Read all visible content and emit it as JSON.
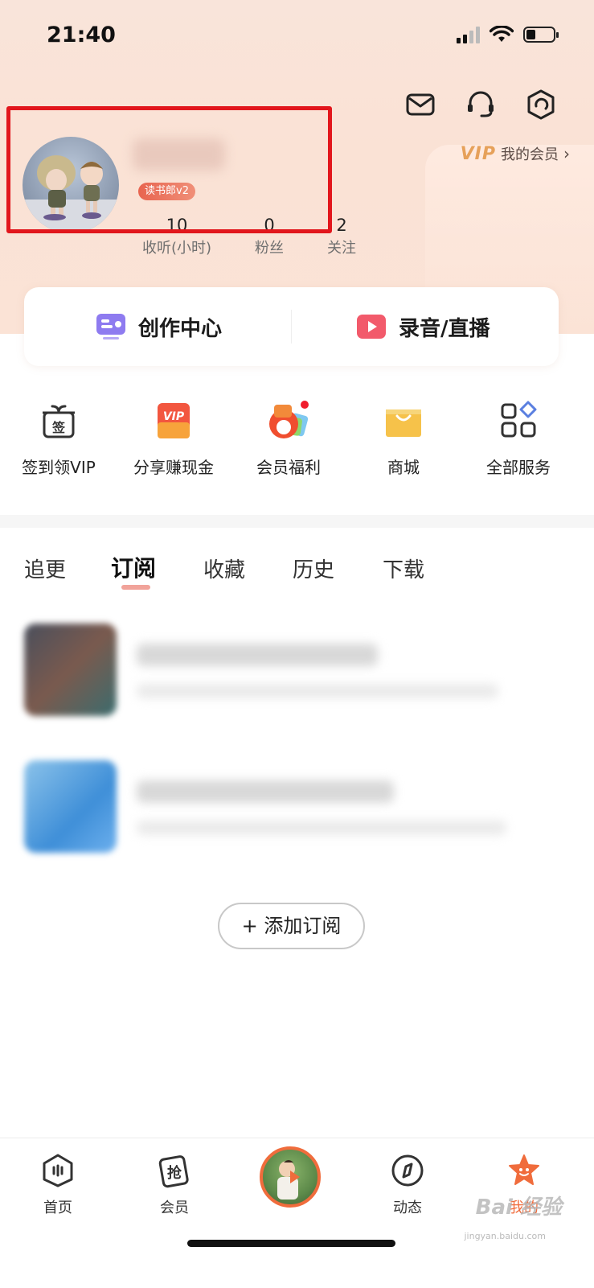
{
  "status_bar": {
    "time": "21:40",
    "battery_level": 0.35
  },
  "profile": {
    "level_badge": "读书郎v2",
    "vip_brand": "VIP",
    "vip_link": "我的会员",
    "stats": [
      {
        "value": "10",
        "label": "收听(小时)"
      },
      {
        "value": "0",
        "label": "粉丝"
      },
      {
        "value": "2",
        "label": "关注"
      }
    ]
  },
  "creator_card": {
    "left_label": "创作中心",
    "right_label": "录音/直播"
  },
  "services": [
    {
      "icon": "gift-checkin-icon",
      "label": "签到领VIP",
      "glyph": "签"
    },
    {
      "icon": "vip-share-icon",
      "label": "分享赚现金",
      "glyph": "VIP"
    },
    {
      "icon": "member-benefits-icon",
      "label": "会员福利"
    },
    {
      "icon": "shopping-bag-icon",
      "label": "商城"
    },
    {
      "icon": "all-services-grid-icon",
      "label": "全部服务"
    }
  ],
  "tabs": [
    "追更",
    "订阅",
    "收藏",
    "历史",
    "下载"
  ],
  "active_tab": "订阅",
  "add_subscription_label": "+ 添加订阅",
  "bottom_nav": [
    {
      "icon": "home-icon",
      "label": "首页"
    },
    {
      "icon": "grab-ticket-icon",
      "label": "会员",
      "glyph": "抢"
    },
    {
      "icon": "player-icon",
      "label": ""
    },
    {
      "icon": "feed-compass-icon",
      "label": "动态"
    },
    {
      "icon": "star-me-icon",
      "label": "我的"
    }
  ],
  "watermark": {
    "main": "Bai 经验",
    "sub": "jingyan.baidu.com"
  },
  "colors": {
    "accent": "#f06c3c",
    "highlight_box": "#e2161c",
    "vip_gold": "#e6a15a"
  }
}
